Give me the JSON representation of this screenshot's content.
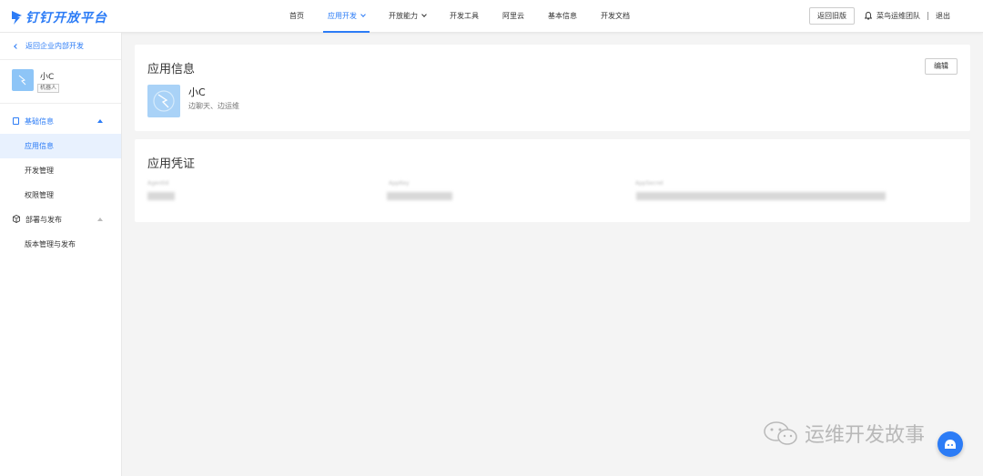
{
  "header": {
    "logo_text": "钉钉开放平台",
    "nav": [
      {
        "label": "首页",
        "active": false,
        "dropdown": false
      },
      {
        "label": "应用开发",
        "active": true,
        "dropdown": true
      },
      {
        "label": "开放能力",
        "active": false,
        "dropdown": true
      },
      {
        "label": "开发工具",
        "active": false,
        "dropdown": false
      },
      {
        "label": "阿里云",
        "active": false,
        "dropdown": false
      },
      {
        "label": "基本信息",
        "active": false,
        "dropdown": false
      },
      {
        "label": "开发文档",
        "active": false,
        "dropdown": false
      }
    ],
    "old_version_button": "返回旧版",
    "team_name": "菜鸟运维团队",
    "logout": "退出"
  },
  "sidebar": {
    "back_link": "返回企业内部开发",
    "app_name": "小C",
    "app_tag": "机器人",
    "groups": [
      {
        "label": "基础信息",
        "icon": "document-icon",
        "items": [
          "应用信息",
          "开发管理",
          "权限管理"
        ],
        "active_item": "应用信息"
      },
      {
        "label": "部署与发布",
        "icon": "cube-icon",
        "items": [
          "版本管理与发布"
        ]
      }
    ]
  },
  "app_info": {
    "title": "应用信息",
    "edit_button": "编辑",
    "name": "小C",
    "description": "边聊天、边运维"
  },
  "credentials": {
    "title": "应用凭证",
    "fields": [
      {
        "label": "AgentId"
      },
      {
        "label": "AppKey"
      },
      {
        "label": "AppSecret"
      }
    ]
  },
  "watermark": "运维开发故事",
  "colors": {
    "accent": "#2c7cf6",
    "active_bg": "#e8f1fe",
    "page_bg": "#f4f4f4"
  }
}
